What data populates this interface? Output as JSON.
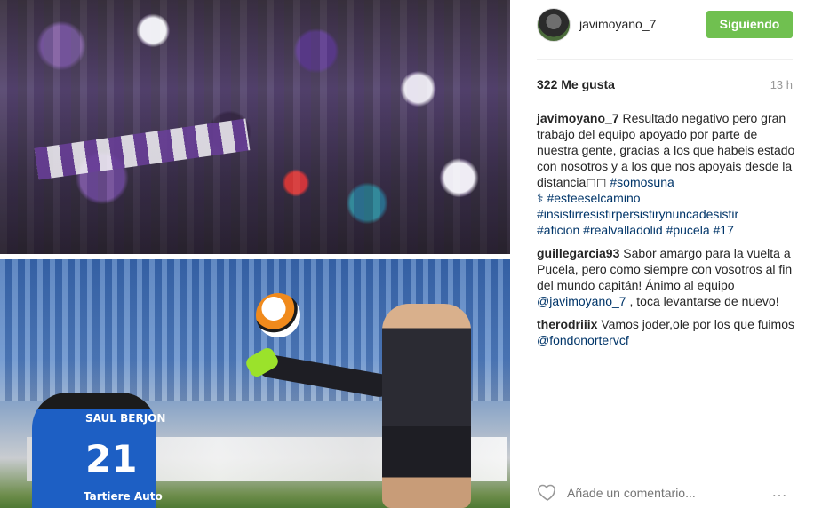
{
  "post": {
    "username": "javimoyano_7",
    "follow_label": "Siguiendo",
    "likes": "322 Me gusta",
    "time": "13 h",
    "caption": {
      "user": "javimoyano_7",
      "text": "Resultado negativo pero gran trabajo del equipo apoyado por parte de nuestra gente, gracias a los que habeis estado con nosotros y a los que nos apoyais desde la distancia◻◻",
      "tags": [
        "#somosuna",
        "⚕",
        "#esteeselcamino",
        "#insistirresistirpersistirynuncadesistir",
        "#aficion",
        "#realvalladolid",
        "#pucela",
        "#17"
      ]
    },
    "comments": [
      {
        "user": "guillegarcia93",
        "text_before": "Sabor amargo para la vuelta a Pucela, pero como siempre con vosotros al fin del mundo capitán! Ánimo al equipo",
        "mention": "@javimoyano_7",
        "text_after": ", toca levantarse de nuevo!"
      },
      {
        "user": "therodriiix",
        "text_before": "Vamos joder,ole por los que fuimos",
        "mention": "@fondonortervcf",
        "text_after": ""
      }
    ],
    "comment_placeholder": "Añade un comentario...",
    "more_label": "…"
  },
  "photo": {
    "jersey_name": "SAUL BERJON",
    "jersey_number": "21",
    "jersey_sponsor": "Tartiere Auto"
  },
  "colors": {
    "follow_button": "#70c050",
    "link": "#003569",
    "muted": "#999999"
  }
}
